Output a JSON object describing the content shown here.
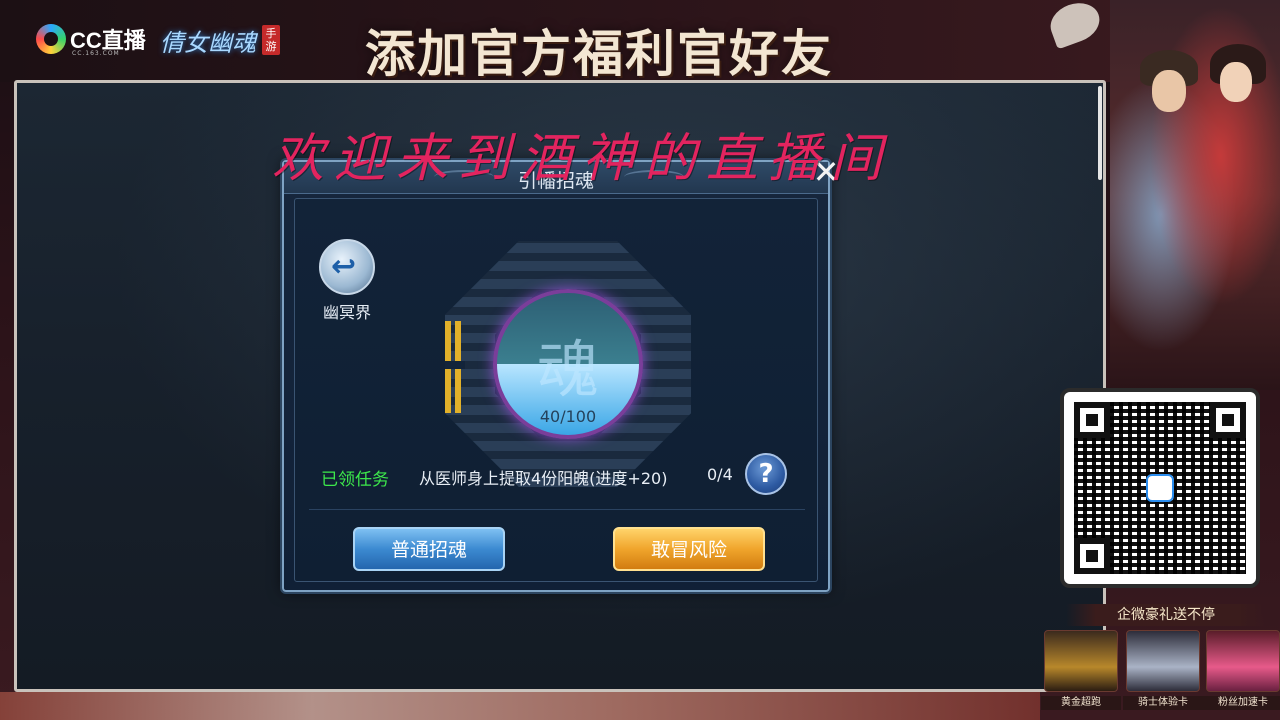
{
  "banner": {
    "platform_logo": "CC直播",
    "platform_sub": "CC.163.COM",
    "game_logo": "倩女幽魂",
    "game_tag": "手游",
    "headline": "添加官方福利官好友"
  },
  "overlay": {
    "welcome_text": "欢迎来到酒神的直播间"
  },
  "dialog": {
    "title": "引幡招魂",
    "close_icon": "close-icon",
    "back_label": "幽冥界",
    "soul_glyph": "魂",
    "soul_progress": "40/100",
    "task_status": "已领任务",
    "task_description": "从医师身上提取4份阳魄(进度+20)",
    "task_count": "0/4",
    "help_label": "?",
    "normal_button": "普通招魂",
    "risk_button": "敢冒风险"
  },
  "promo": {
    "title": "企微豪礼送不停",
    "items": [
      {
        "label": "黄金超跑"
      },
      {
        "label": "骑士体验卡"
      },
      {
        "label": "粉丝加速卡"
      }
    ]
  },
  "colors": {
    "welcome": "#e3245f",
    "task_status": "#3de84b",
    "risk_button": "#f0a52c",
    "normal_button": "#3c8ad1"
  }
}
